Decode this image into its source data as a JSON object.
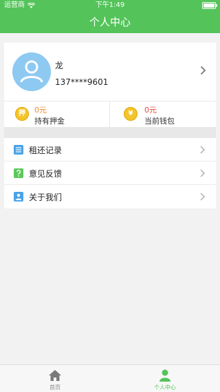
{
  "status_bar": {
    "carrier": "运营商",
    "time": "下午1:49"
  },
  "header": {
    "title": "个人中心"
  },
  "profile": {
    "name": "龙",
    "phone": "137****9601"
  },
  "wallet": {
    "deposit_icon_char": "押",
    "deposit_amount": "0元",
    "deposit_label": "持有押金",
    "balance_icon_char": "¥",
    "balance_amount": "0元",
    "balance_label": "当前钱包"
  },
  "menu": {
    "items": [
      {
        "label": "租还记录",
        "icon": "list-icon",
        "color": "#4aa3e8"
      },
      {
        "label": "意见反馈",
        "icon": "question-icon",
        "color": "#5cc85a"
      },
      {
        "label": "关于我们",
        "icon": "person-icon",
        "color": "#4aa3e8"
      }
    ]
  },
  "tabbar": {
    "home_label": "首页",
    "me_label": "个人中心"
  },
  "colors": {
    "primary": "#54c45a",
    "deposit_amount": "#f08a2c",
    "balance_amount": "#e84b3c",
    "avatar_bg": "#8ec9f2"
  }
}
